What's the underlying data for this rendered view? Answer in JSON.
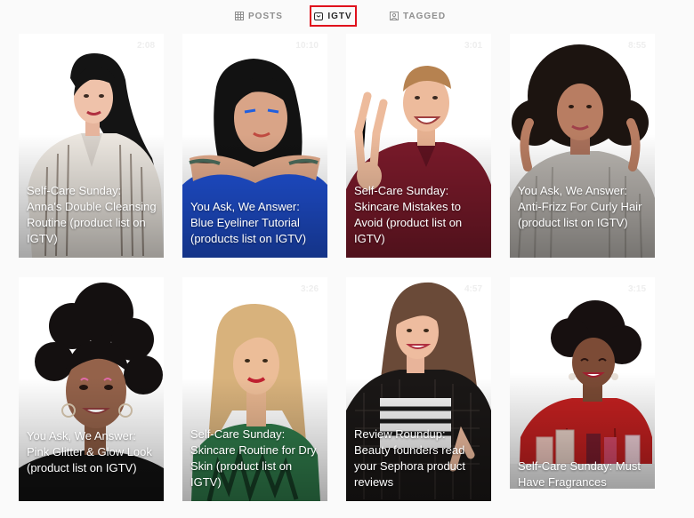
{
  "tabs": [
    {
      "label": "POSTS",
      "icon": "grid-icon",
      "active": false
    },
    {
      "label": "IGTV",
      "icon": "igtv-icon",
      "active": true
    },
    {
      "label": "TAGGED",
      "icon": "tagged-icon",
      "active": false
    }
  ],
  "colors": {
    "active_tab_border": "#e0101c",
    "page_bg": "#fafafa"
  },
  "videos": [
    {
      "duration": "2:08",
      "title": "Self-Care Sunday: Anna's Double Cleansing Routine (product list on IGTV)"
    },
    {
      "duration": "10:10",
      "title": "You Ask, We Answer: Blue Eyeliner Tutorial (products list on IGTV)"
    },
    {
      "duration": "3:01",
      "title": "Self-Care Sunday: Skincare Mistakes to Avoid (product list on IGTV)"
    },
    {
      "duration": "8:55",
      "title": "You Ask, We Answer: Anti-Frizz For Curly Hair (product list on IGTV)"
    },
    {
      "duration": "",
      "title": "You Ask, We Answer: Pink Glitter & Glow Look (product list on IGTV)"
    },
    {
      "duration": "3:26",
      "title": "Self-Care Sunday: Skincare Routine for Dry Skin (product list on IGTV)"
    },
    {
      "duration": "4:57",
      "title": "Review Roundup: Beauty founders read your Sephora product reviews"
    },
    {
      "duration": "3:15",
      "title": "Self-Care Sunday: Must Have Fragrances"
    }
  ]
}
